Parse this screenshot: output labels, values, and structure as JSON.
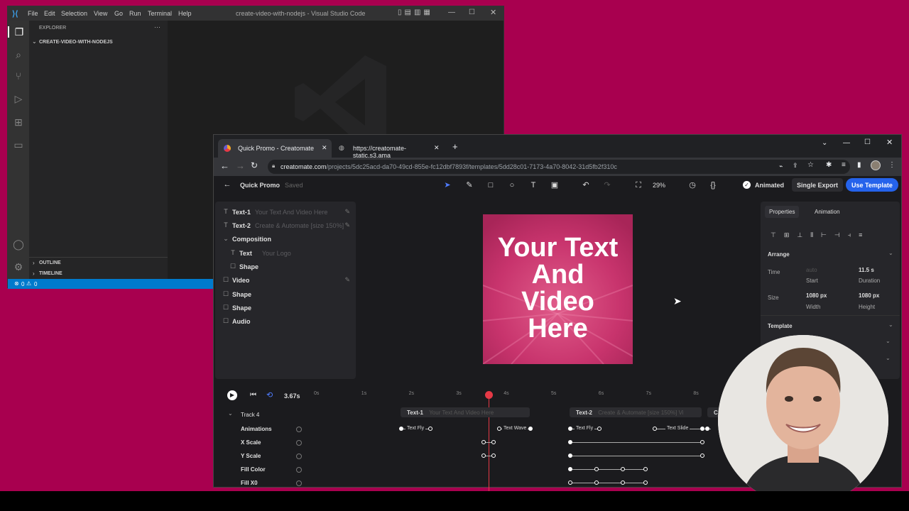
{
  "vscode": {
    "menu": [
      "File",
      "Edit",
      "Selection",
      "View",
      "Go",
      "Run",
      "Terminal",
      "Help"
    ],
    "title": "create-video-with-nodejs - Visual Studio Code",
    "explorer_label": "EXPLORER",
    "folder_name": "CREATE-VIDEO-WITH-NODEJS",
    "outline_label": "OUTLINE",
    "timeline_label": "TIMELINE",
    "status_errors": "0",
    "status_warnings": "0",
    "more_glyph": "···"
  },
  "chrome": {
    "tabs": [
      {
        "title": "Quick Promo - Creatomate"
      },
      {
        "title": "https://creatomate-static.s3.ama"
      }
    ],
    "url_domain": "creatomate.com",
    "url_path": "/projects/5dc25acd-da70-49cd-855e-fc12dbf7893f/templates/5dd28c01-7173-4a70-8042-31d5fb2f310c"
  },
  "app": {
    "project_name": "Quick Promo",
    "save_status": "Saved",
    "zoom": "29%",
    "animated_label": "Animated",
    "single_export_label": "Single Export",
    "use_template_label": "Use Template",
    "layers": [
      {
        "name": "Text-1",
        "sub": "Your Text And Video Here",
        "icon": "T",
        "indent": 0,
        "editable": true
      },
      {
        "name": "Text-2",
        "sub": "Create & Automate [size 150%]...",
        "icon": "T",
        "indent": 0,
        "editable": true
      },
      {
        "name": "Composition",
        "sub": "",
        "icon": "⌄",
        "indent": 0,
        "editable": false
      },
      {
        "name": "Text",
        "sub": "Your Logo",
        "icon": "T",
        "indent": 1,
        "editable": false
      },
      {
        "name": "Shape",
        "sub": "",
        "icon": "☐",
        "indent": 1,
        "editable": false
      },
      {
        "name": "Video",
        "sub": "",
        "icon": "☐",
        "indent": 0,
        "editable": true
      },
      {
        "name": "Shape",
        "sub": "",
        "icon": "☐",
        "indent": 0,
        "editable": false
      },
      {
        "name": "Shape",
        "sub": "",
        "icon": "☐",
        "indent": 0,
        "editable": false
      },
      {
        "name": "Audio",
        "sub": "",
        "icon": "☐",
        "indent": 0,
        "editable": false
      }
    ],
    "canvas_text": [
      "Your Text",
      "And",
      "Video",
      "Here"
    ],
    "props": {
      "tabs": [
        "Properties",
        "Animation"
      ],
      "arrange_label": "Arrange",
      "time_label": "Time",
      "time_start": "auto",
      "time_start_label": "Start",
      "time_duration": "11.5 s",
      "time_duration_label": "Duration",
      "size_label": "Size",
      "size_width": "1080 px",
      "size_width_label": "Width",
      "size_height": "1080 px",
      "size_height_label": "Height",
      "template_label": "Template"
    },
    "timeline": {
      "current_time": "3.67s",
      "ticks": [
        "0s",
        "1s",
        "2s",
        "3s",
        "4s",
        "5s",
        "6s",
        "7s",
        "8s"
      ],
      "track_label": "Track 4",
      "clip1_name": "Text-1",
      "clip1_sub": "Your Text And Video Here",
      "clip2_name": "Text-2",
      "clip2_sub": "Create & Automate [size 150%] Vi",
      "clip3_name": "C",
      "rows": [
        "Animations",
        "X Scale",
        "Y Scale",
        "Fill Color",
        "Fill X0"
      ],
      "anim_labels": [
        "Text Fly",
        "Text Wave",
        "Text Fly",
        "Text Slide"
      ]
    }
  },
  "colors": {
    "desktop": "#a8004f",
    "accent_blue": "#2563eb",
    "playhead": "#e53946",
    "canvas_pink": "#c8346d",
    "vscode_status": "#007acc"
  }
}
